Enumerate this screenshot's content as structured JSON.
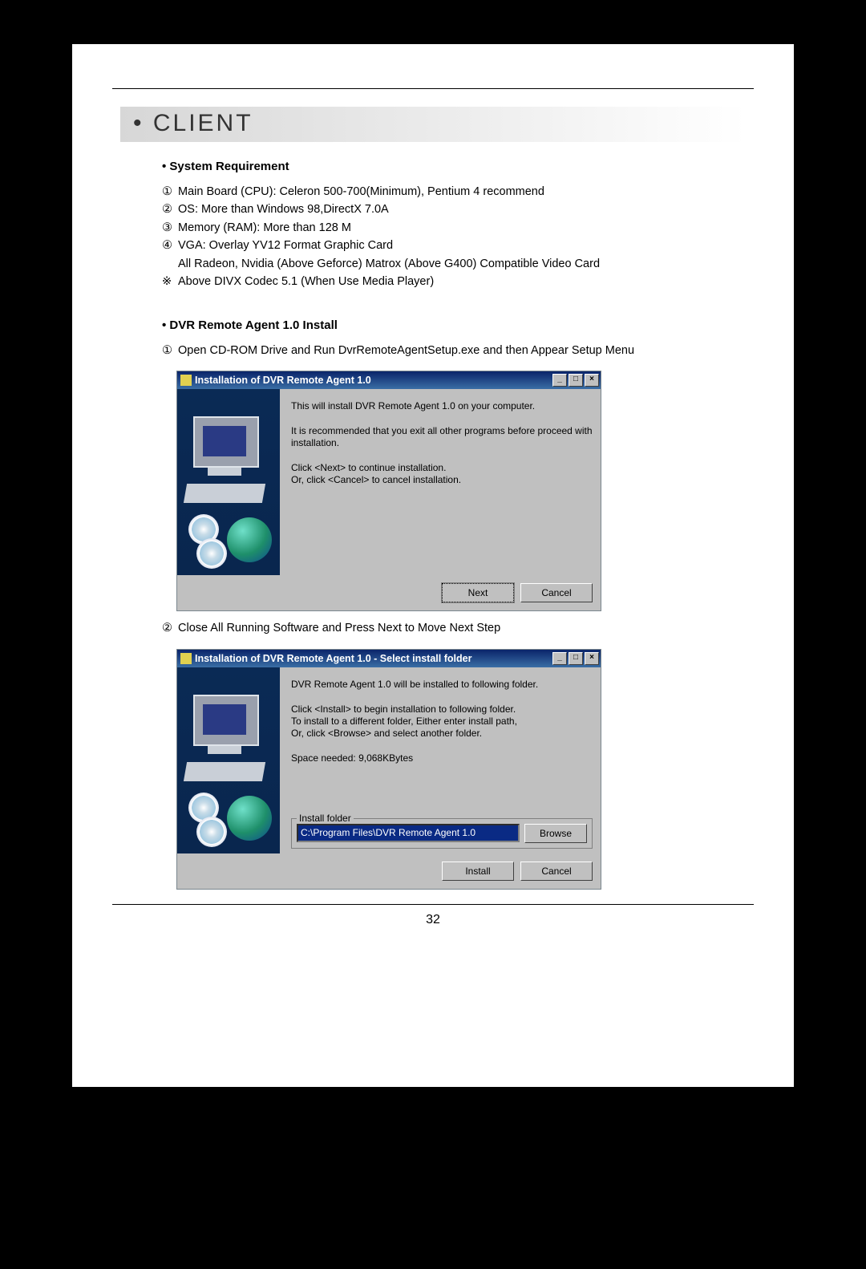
{
  "heading": "• CLIENT",
  "sections": {
    "sysreq": {
      "title": "• System Requirement",
      "items": {
        "n1": "①",
        "t1": "Main Board (CPU): Celeron 500-700(Minimum), Pentium 4 recommend",
        "n2": "②",
        "t2": "OS: More than Windows 98,DirectX 7.0A",
        "n3": "③",
        "t3": "Memory (RAM): More than 128 M",
        "n4": "④",
        "t4": "VGA: Overlay YV12 Format Graphic Card",
        "t4b": "All Radeon, Nvidia (Above Geforce) Matrox (Above G400) Compatible Video Card",
        "nx": "※",
        "tx": "Above DIVX Codec 5.1 (When Use Media Player)"
      }
    },
    "install": {
      "title": "• DVR Remote Agent 1.0 Install",
      "step1_num": "①",
      "step1_text": "Open CD-ROM Drive and Run DvrRemoteAgentSetup.exe and then Appear Setup Menu",
      "step2_num": "②",
      "step2_text": "Close All Running Software and Press Next to Move Next Step"
    }
  },
  "dialog1": {
    "title": "Installation of DVR Remote Agent 1.0",
    "msg1": "This will install DVR Remote Agent 1.0 on your computer.",
    "msg2": "It is recommended that you exit all other programs before proceed with installation.",
    "msg3": "Click <Next> to continue installation.\nOr, click <Cancel> to cancel installation.",
    "btn_next": "Next",
    "btn_cancel": "Cancel",
    "btn_min": "_",
    "btn_max": "□",
    "btn_close": "×"
  },
  "dialog2": {
    "title": "Installation of DVR Remote Agent 1.0 - Select install folder",
    "msg1": "DVR Remote Agent 1.0 will be installed to following folder.",
    "msg2": "Click <Install> to begin installation to following folder.\nTo install to a different folder, Either enter install path,\nOr, click <Browse> and select another folder.",
    "msg3": "Space needed: 9,068KBytes",
    "group_label": "Install folder",
    "path_value": "C:\\Program Files\\DVR Remote Agent 1.0",
    "btn_browse": "Browse",
    "btn_install": "Install",
    "btn_cancel": "Cancel",
    "btn_min": "_",
    "btn_max": "□",
    "btn_close": "×"
  },
  "page_number": "32"
}
